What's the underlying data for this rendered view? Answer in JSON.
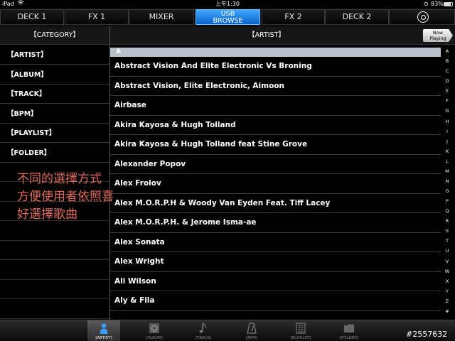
{
  "status": {
    "device": "iPad",
    "time": "上午1:30",
    "battery": "83%"
  },
  "tabs": {
    "deck1": "DECK 1",
    "fx1": "FX 1",
    "mixer": "MIXER",
    "usb_line1": "USB",
    "usb_line2": "BROWSE",
    "fx2": "FX 2",
    "deck2": "DECK 2"
  },
  "category_header": "【CATEGORY】",
  "artist_header": "【ARTIST】",
  "now_playing_line1": "Now",
  "now_playing_line2": "Playing",
  "categories": [
    "【ARTIST】",
    "【ALBUM】",
    "【TRACK】",
    "【BPM】",
    "【PLAYLIST】",
    "【FOLDER】"
  ],
  "section_letter": "A",
  "artists": [
    "Abstract Vision And Elite Electronic Vs Broning",
    "Abstract Vision, Elite Electronic, Aimoon",
    "Airbase",
    "Akira Kayosa & Hugh Tolland",
    "Akira Kayosa & Hugh Tolland feat Stine Grove",
    "Alexander Popov",
    "Alex Frolov",
    "Alex M.O.R.P.H & Woody Van Eyden Feat. Tiff Lacey",
    "Alex M.O.R.P.H. & Jerome Isma-ae",
    "Alex Sonata",
    "Alex Wright",
    "Ali Wilson",
    "Aly & Fila"
  ],
  "alphabet": [
    "A",
    "B",
    "C",
    "D",
    "E",
    "F",
    "G",
    "H",
    "I",
    "J",
    "K",
    "L",
    "M",
    "N",
    "O",
    "P",
    "Q",
    "R",
    "S",
    "T",
    "U",
    "V",
    "W",
    "X",
    "Y",
    "Z",
    "#"
  ],
  "annotation_lines": [
    "不同的選擇方式",
    "方便使用者依照喜",
    "好選擇歌曲"
  ],
  "bottom_tabs": [
    "[ARTIST]",
    "[ALBUM]",
    "[TRACK]",
    "[BPM]",
    "[PLAYLIST]",
    "[FOLDER]"
  ],
  "watermark": "#2557632",
  "colors": {
    "accent": "#1a7fe0",
    "section_bar": "#b8c1c9",
    "annotation": "#e06a5a"
  }
}
